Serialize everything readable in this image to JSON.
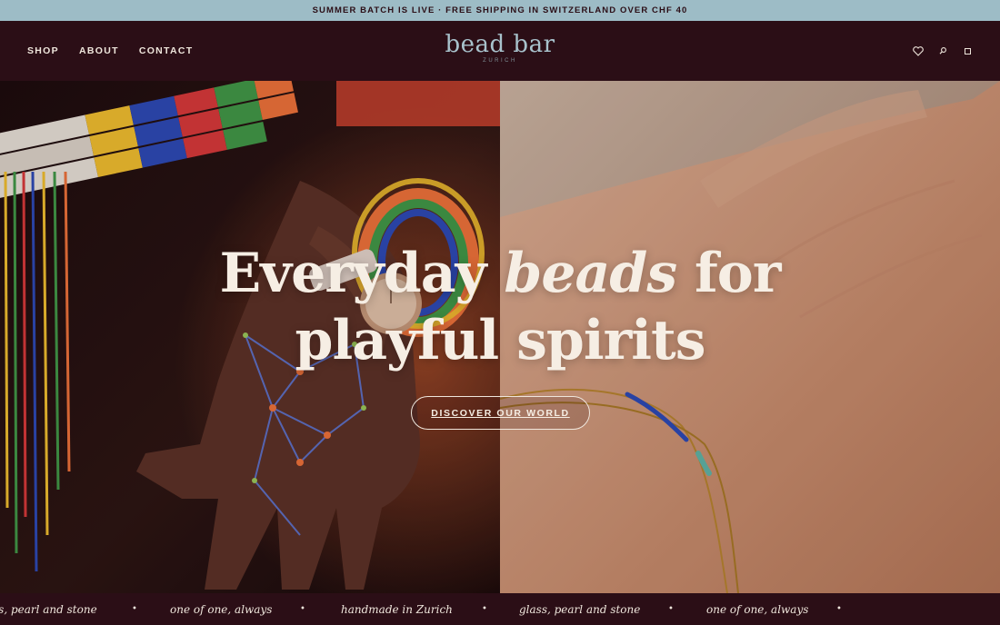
{
  "announcement": {
    "text": "SUMMER BATCH IS LIVE · FREE SHIPPING IN SWITZERLAND OVER CHF 40"
  },
  "nav": {
    "items": [
      "SHOP",
      "ABOUT",
      "CONTACT"
    ]
  },
  "logo": {
    "name": "bead bar",
    "sub": "ZURICH"
  },
  "header_icons": [
    "heart-icon",
    "search-icon",
    "bag-icon"
  ],
  "hero": {
    "headline_part1": "Everyday ",
    "headline_em": "beads",
    "headline_part2": " for",
    "headline_line2": "playful spirits",
    "cta_label": "DISCOVER OUR WORLD"
  },
  "marquee": {
    "items": [
      "ss, pearl and stone",
      "one of one, always",
      "handmade in Zurich",
      "glass, pearl and stone",
      "one of one, always"
    ],
    "separator": "•"
  },
  "colors": {
    "announcement_bg": "#9dbcc6",
    "header_bg": "#2b0e16",
    "logo": "#a8c2cc",
    "text_light": "#efe6dc"
  }
}
